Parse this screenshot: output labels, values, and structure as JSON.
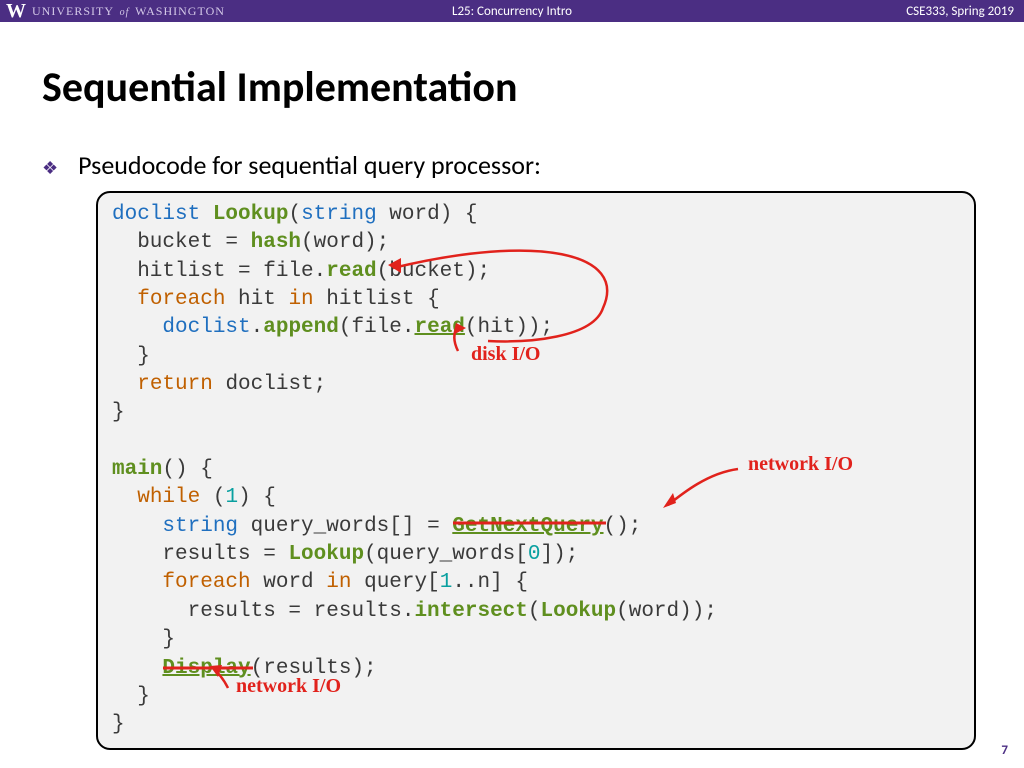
{
  "header": {
    "university_w": "W",
    "university_text_1": "UNIVERSITY",
    "university_text_of": "of",
    "university_text_2": "WASHINGTON",
    "lecture": "L25:  Concurrency Intro",
    "course": "CSE333, Spring 2019"
  },
  "title": "Sequential Implementation",
  "bullet_text": "Pseudocode for sequential query processor:",
  "code": {
    "l1_a": "doclist",
    "l1_b": "Lookup",
    "l1_c": "(",
    "l1_d": "string",
    "l1_e": " word) {",
    "l2_a": "  bucket = ",
    "l2_b": "hash",
    "l2_c": "(word);",
    "l3_a": "  hitlist = file.",
    "l3_b": "read",
    "l3_c": "(bucket);",
    "l4_a": "  ",
    "l4_b": "foreach",
    "l4_c": " hit ",
    "l4_d": "in",
    "l4_e": " hitlist {",
    "l5_a": "    ",
    "l5_b": "doclist",
    "l5_c": ".",
    "l5_d": "append",
    "l5_e": "(file.",
    "l5_f": "read",
    "l5_g": "(hit));",
    "l6": "  }",
    "l7_a": "  ",
    "l7_b": "return",
    "l7_c": " doclist;",
    "l8": "}",
    "l9": "",
    "l10_a": "main",
    "l10_b": "() {",
    "l11_a": "  ",
    "l11_b": "while",
    "l11_c": " (",
    "l11_d": "1",
    "l11_e": ") {",
    "l12_a": "    ",
    "l12_b": "string",
    "l12_c": " query_words[] = ",
    "l12_d": "GetNextQuery",
    "l12_e": "();",
    "l13_a": "    results = ",
    "l13_b": "Lookup",
    "l13_c": "(query_words[",
    "l13_d": "0",
    "l13_e": "]);",
    "l14_a": "    ",
    "l14_b": "foreach",
    "l14_c": " word ",
    "l14_d": "in",
    "l14_e": " query[",
    "l14_f": "1",
    "l14_g": "..n] {",
    "l15_a": "      results = results.",
    "l15_b": "intersect",
    "l15_c": "(",
    "l15_d": "Lookup",
    "l15_e": "(word));",
    "l16": "    }",
    "l17_a": "    ",
    "l17_b": "Display",
    "l17_c": "(results);",
    "l18": "  }",
    "l19": "}"
  },
  "annotations": {
    "disk_io": "disk I/O",
    "network_io_1": "network I/O",
    "network_io_2": "network I/O"
  },
  "slide_number": "7"
}
